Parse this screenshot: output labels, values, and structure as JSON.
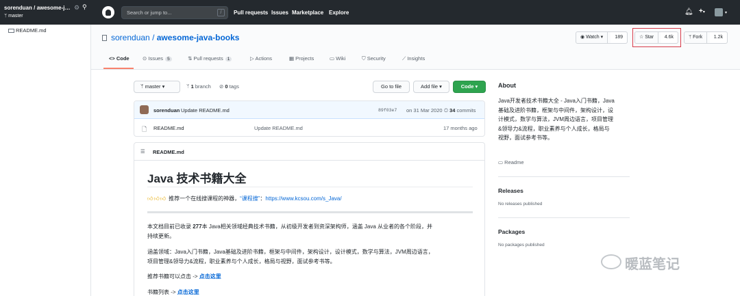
{
  "tree": {
    "repo": "sorenduan / awesome-java-books",
    "branch": "master",
    "file": "README.md"
  },
  "header": {
    "search_placeholder": "Search or jump to...",
    "search_key": "/",
    "nav": [
      "Pull requests",
      "Issues",
      "Marketplace",
      "Explore"
    ]
  },
  "repo": {
    "owner": "sorenduan",
    "separator": "/",
    "name": "awesome-java-books",
    "watch_label": "Watch",
    "watch_count": "189",
    "star_label": "Star",
    "star_count": "4.6k",
    "fork_label": "Fork",
    "fork_count": "1.2k",
    "tabs": [
      {
        "label": "Code"
      },
      {
        "label": "Issues",
        "badge": "5"
      },
      {
        "label": "Pull requests",
        "badge": "1"
      },
      {
        "label": "Actions"
      },
      {
        "label": "Projects"
      },
      {
        "label": "Wiki"
      },
      {
        "label": "Security"
      },
      {
        "label": "Insights"
      }
    ]
  },
  "filenav": {
    "branch": "master",
    "branch_count": "1",
    "branch_label": "branch",
    "tag_count": "0",
    "tag_label": "tags",
    "go_to_file": "Go to file",
    "add_file": "Add file",
    "code": "Code"
  },
  "commit": {
    "author": "sorenduan",
    "message": "Update README.md",
    "sha": "89f03e7",
    "date": "on 31 Mar 2020",
    "count": "34",
    "count_label": "commits"
  },
  "files": [
    {
      "name": "README.md",
      "message": "Update README.md",
      "age": "17 months ago"
    }
  ],
  "readme": {
    "filename": "README.md",
    "title": "Java 技术书籍大全",
    "promo_prefix": "推荐一个在线搜课程的神器，",
    "promo_link": "“课程搜”",
    "promo_colon": "：",
    "promo_url": "https://www.kcsou.com/s_Java/",
    "para1_a": "本文档目前已收录 ",
    "para1_num": "277",
    "para1_b": "本 Java相关领域经典技术书籍，从初级开发者到资深架构师，涵盖 Java 从业者的各个阶段，并",
    "para1_c": "持续更新。",
    "para2_a": "涵盖领域：Java入门书籍，Java基础及进阶书籍，框架与中间件，架构设计，设计模式，数学与算法，JVM周边语言，",
    "para2_b": "项目管理&领导力&流程，职业素养与个人成长，格局与视野，面试参考书等。",
    "rec_text": "推荐书籍可以点击 -> ",
    "rec_link": "点击这里",
    "list_text": "书籍列表 -> ",
    "list_link": "点击这里"
  },
  "sidebar": {
    "about_title": "About",
    "about_text": "Java开发者技术书籍大全 - Java入门书籍，Java基础及进阶书籍，框架与中间件，架构设计，设计模式，数学与算法，JVM周边语言，项目管理&领导力&流程，职业素养与个人成长，格局与视野，面试参考书等。",
    "readme_link": "Readme",
    "releases_title": "Releases",
    "releases_text": "No releases published",
    "packages_title": "Packages",
    "packages_text": "No packages published"
  },
  "watermark": {
    "text": "暖蓝笔记"
  }
}
